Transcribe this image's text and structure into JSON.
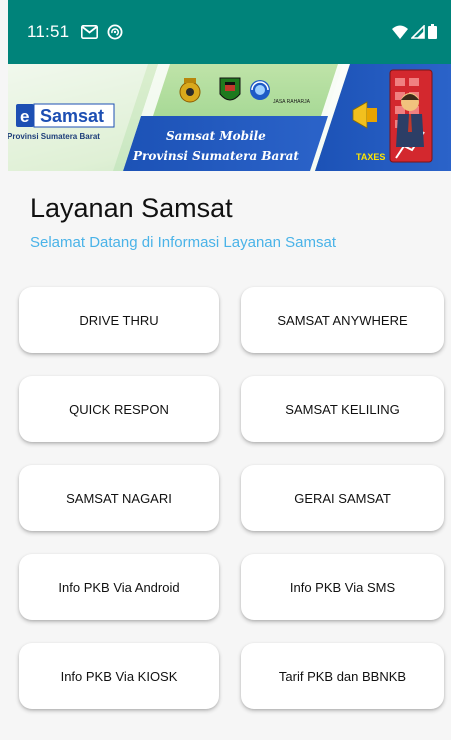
{
  "status_bar": {
    "time": "11:51"
  },
  "banner": {
    "brand_prefix": "e",
    "brand_name": "Samsat",
    "brand_region": "Provinsi Sumatera Barat",
    "app_name_line1": "Samsat Mobile",
    "app_name_line2": "Provinsi Sumatera Barat",
    "partner_label": "JASA RAHARJA",
    "taxes_label": "TAXES"
  },
  "header": {
    "title": "Layanan Samsat",
    "subtitle": "Selamat Datang di Informasi Layanan Samsat"
  },
  "services": [
    {
      "label": "DRIVE THRU"
    },
    {
      "label": "SAMSAT ANYWHERE"
    },
    {
      "label": "QUICK RESPON"
    },
    {
      "label": "SAMSAT KELILING"
    },
    {
      "label": "SAMSAT NAGARI"
    },
    {
      "label": "GERAI SAMSAT"
    },
    {
      "label": "Info PKB Via Android"
    },
    {
      "label": "Info PKB Via SMS"
    },
    {
      "label": "Info PKB Via KIOSK"
    },
    {
      "label": "Tarif PKB dan BBNKB"
    }
  ],
  "colors": {
    "status_bar": "#00837a",
    "subtitle": "#4ab3e8",
    "banner_blue": "#1f54b8",
    "background": "#f6f6f6"
  }
}
